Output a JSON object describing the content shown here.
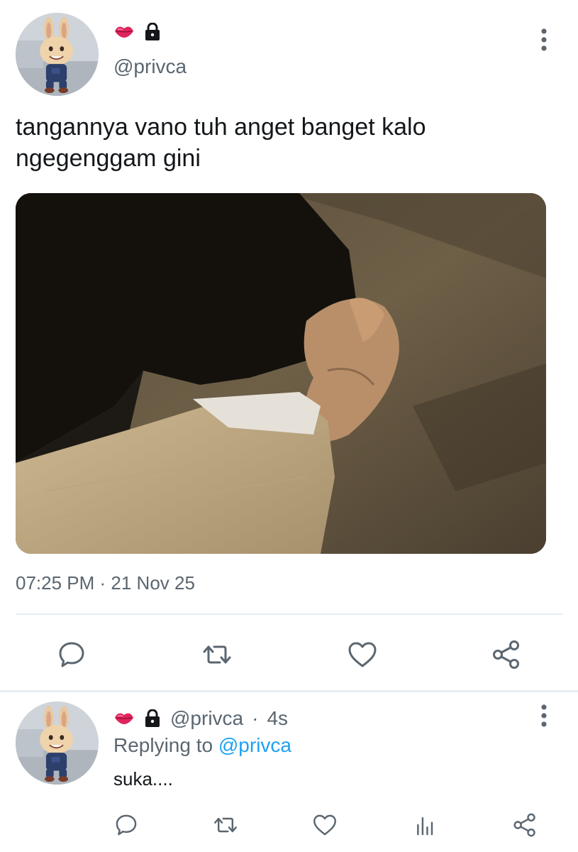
{
  "main_tweet": {
    "icons": [
      "kiss-mark-icon",
      "lock-icon"
    ],
    "handle": "@privca",
    "text_line1": "tangannya vano tuh anget banget kalo",
    "text_line2": "ngegenggam gini",
    "timestamp": "07:25 PM · 21 Nov 25",
    "actions": [
      "reply-icon",
      "retweet-icon",
      "like-icon",
      "share-icon"
    ]
  },
  "reply_tweet": {
    "icons": [
      "kiss-mark-icon",
      "lock-icon"
    ],
    "handle": "@privca",
    "separator": "·",
    "time": "4s",
    "replying_prefix": "Replying to ",
    "replying_mention": "@privca",
    "text": "suka....",
    "actions": [
      "reply-icon",
      "retweet-icon",
      "like-icon",
      "stats-icon",
      "share-icon"
    ]
  },
  "colors": {
    "text_primary": "#14171a",
    "text_secondary": "#5b6670",
    "accent": "#1da1f2",
    "divider": "#e6ecf0",
    "kiss_red": "#e0245e"
  }
}
